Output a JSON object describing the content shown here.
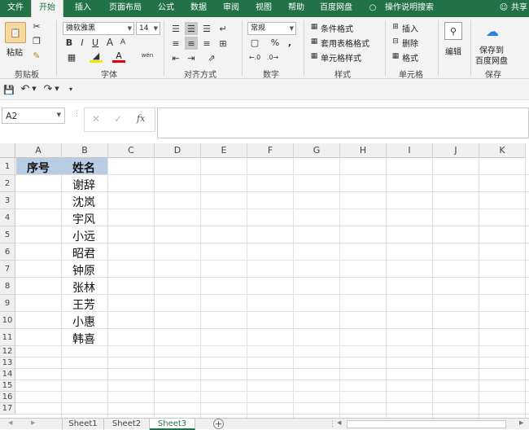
{
  "ribbon_tabs": [
    "文件",
    "开始",
    "插入",
    "页面布局",
    "公式",
    "数据",
    "审阅",
    "视图",
    "帮助",
    "百度网盘",
    "操作说明搜索"
  ],
  "active_tab": "开始",
  "share_label": "共享",
  "clipboard": {
    "paste": "粘贴",
    "group": "剪贴板"
  },
  "font": {
    "name": "微软雅黑",
    "size": "14",
    "bold": "B",
    "italic": "I",
    "underline": "U",
    "grow": "A",
    "shrink": "A",
    "color_letter": "A",
    "group": "字体",
    "wen": "wén"
  },
  "alignment": {
    "group": "对齐方式"
  },
  "number": {
    "format": "常规",
    "percent": "%",
    "comma": ",",
    "group": "数字"
  },
  "styles": {
    "cond": "条件格式",
    "table": "套用表格格式",
    "cell": "单元格样式",
    "group": "样式"
  },
  "cells": {
    "insert": "插入",
    "delete": "删除",
    "format": "格式",
    "group": "单元格"
  },
  "editing": {
    "label": "编辑"
  },
  "save": {
    "line1": "保存到",
    "line2": "百度网盘",
    "group": "保存"
  },
  "formula_bar": {
    "name_box": "A2",
    "fx": "fx",
    "formula": ""
  },
  "columns": [
    "A",
    "B",
    "C",
    "D",
    "E",
    "F",
    "G",
    "H",
    "I",
    "J",
    "K"
  ],
  "rows": [
    "1",
    "2",
    "3",
    "4",
    "5",
    "6",
    "7",
    "8",
    "9",
    "10",
    "11",
    "12",
    "13",
    "14",
    "15",
    "16",
    "17"
  ],
  "header_row": {
    "a": "序号",
    "b": "姓名"
  },
  "names": [
    "谢辞",
    "沈岚",
    "宇风",
    "小远",
    "昭君",
    "钟原",
    "张林",
    "王芳",
    "小惠",
    "韩喜"
  ],
  "sheets": [
    "Sheet1",
    "Sheet2",
    "Sheet3"
  ],
  "active_sheet": "Sheet3",
  "colors": {
    "accent": "#217346",
    "header_fill": "#b8cce4"
  }
}
